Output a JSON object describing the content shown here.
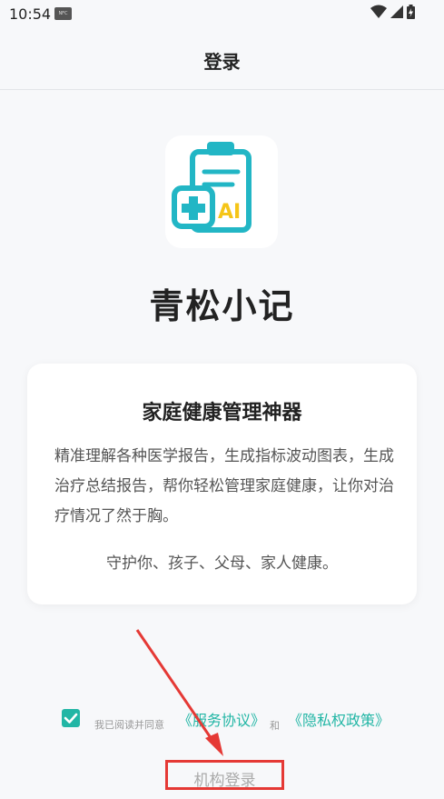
{
  "status_bar": {
    "time": "10:54",
    "nfc_icon_text": "NFC"
  },
  "app_bar": {
    "title": "登录"
  },
  "logo": {
    "badge_text": "AI",
    "accent_color": "#22b6c5",
    "badge_color": "#f5c518"
  },
  "app_name": "青松小记",
  "card": {
    "title": "家庭健康管理神器",
    "description": "精准理解各种医学报告，生成指标波动图表，生成治疗总结报告，帮你轻松管理家庭健康，让你对治疗情况了然于胸。",
    "slogan": "守护你、孩子、父母、家人健康。"
  },
  "agreement": {
    "prefix": "我已阅读并同意",
    "service_link": "《服务协议》",
    "and_text": "和",
    "privacy_link": "《隐私权政策》",
    "checked": true
  },
  "org_login": {
    "label": "机构登录"
  },
  "colors": {
    "accent": "#22b6a5",
    "annotation": "#e53935"
  }
}
